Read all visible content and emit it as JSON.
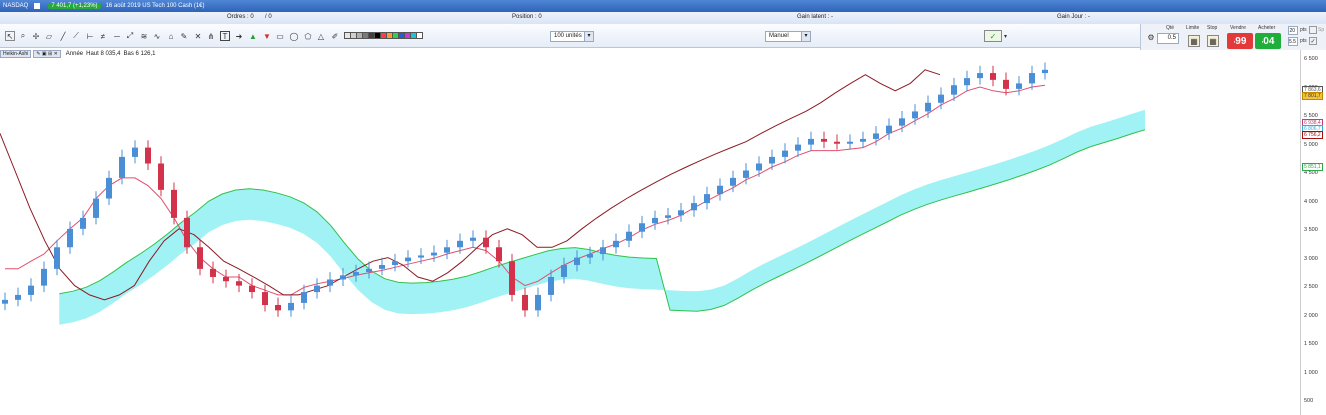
{
  "titlebar": {
    "market": "NASDAQ",
    "price_badge": "7 401,7 (+1,23%)",
    "instrument": "16 août 2019 US Tech 100 Cash (1€)"
  },
  "infobar": {
    "ordres": "Ordres : 0",
    "ordres_sep": "/ 0",
    "position": "Position : 0",
    "gain_latent": "Gain latent : -",
    "gain_jour": "Gain Jour : -"
  },
  "toolbar": {
    "units_dropdown": "100 unités",
    "mode_dropdown": "Manuel",
    "swatches": [
      "#e6e6e6",
      "#d0d0d0",
      "#b0b0b0",
      "#7a7a7a",
      "#404040",
      "#000000",
      "#ff4040",
      "#ff9b2f",
      "#2fd14a",
      "#2a5bd7",
      "#c33dd3",
      "#1fc3d6",
      "#ffffff"
    ]
  },
  "order_panel": {
    "qty_label": "Qté",
    "qty_value": "0.5",
    "limite_label": "Limite",
    "stop_label": "Stop",
    "vendre_label": "Vendre",
    "vendre_value": "99",
    "acheter_label": "Acheter",
    "acheter_value": "04",
    "pts_label": "pts",
    "pts_value_1": "20",
    "pts_value_2": "5.5",
    "sp_label": "Sp",
    "sell_color": "#e23a3a",
    "buy_color": "#1fae3a"
  },
  "chart_header": {
    "style": "Heikin-Ashi",
    "period": "Année",
    "high": "Haut 8 035,4",
    "low": "Bas 6 126,1"
  },
  "y_axis": {
    "ticks": [
      "6 500",
      "6 000",
      "5 500",
      "5 000",
      "4 500",
      "4 000",
      "3 500",
      "3 000",
      "2 500",
      "2 000",
      "1 500",
      "1 000",
      "500"
    ],
    "badges": [
      {
        "text": "7 863,6",
        "color": "#555555"
      },
      {
        "text": "7 801,7",
        "color": "#c08a00"
      },
      {
        "text": "6 938,4",
        "color": "#c04070"
      },
      {
        "text": "6 806,7",
        "color": "#3aa8d8"
      },
      {
        "text": "6 756,2",
        "color": "#a01010"
      },
      {
        "text": "5 851,1",
        "color": "#2fa84a"
      }
    ]
  },
  "chart_data": {
    "type": "candlestick",
    "y_scale": "log",
    "ylim": [
      500,
      8500
    ],
    "series": {
      "price": [
        1250,
        1300,
        1400,
        1600,
        1900,
        2200,
        2400,
        2800,
        3300,
        3900,
        4200,
        3700,
        3000,
        2400,
        1900,
        1600,
        1500,
        1450,
        1400,
        1330,
        1200,
        1150,
        1220,
        1330,
        1400,
        1470,
        1520,
        1560,
        1600,
        1650,
        1700,
        1750,
        1780,
        1820,
        1900,
        2000,
        2050,
        1900,
        1700,
        1300,
        1150,
        1300,
        1500,
        1650,
        1750,
        1800,
        1900,
        2000,
        2150,
        2300,
        2400,
        2450,
        2550,
        2700,
        2900,
        3100,
        3300,
        3500,
        3700,
        3900,
        4100,
        4300,
        4500,
        4400,
        4350,
        4400,
        4500,
        4700,
        5000,
        5300,
        5600,
        6000,
        6400,
        6900,
        7300,
        7600,
        7200,
        6700,
        7000,
        7600,
        7800
      ],
      "red_line": [
        1600,
        1600,
        1700,
        1800,
        2000,
        2200,
        2400,
        2800,
        3100,
        3300,
        3300,
        3100,
        2800,
        2400,
        2000,
        1750,
        1600,
        1500,
        1500,
        1400,
        1350,
        1300,
        1300,
        1380,
        1420,
        1450,
        1480,
        1520,
        1550,
        1580,
        1620,
        1660,
        1700,
        1740,
        1800,
        1850,
        1900,
        1850,
        1700,
        1500,
        1400,
        1450,
        1550,
        1650,
        1730,
        1800,
        1880,
        1950,
        2050,
        2180,
        2280,
        2350,
        2450,
        2600,
        2750,
        2900,
        3050,
        3250,
        3400,
        3600,
        3750,
        3950,
        4100,
        4100,
        4100,
        4150,
        4200,
        4400,
        4700,
        4900,
        5200,
        5500,
        5900,
        6200,
        6600,
        6800,
        6600,
        6500,
        6600,
        6800,
        6900
      ],
      "lagging_line": [
        4700,
        3500,
        2600,
        2000,
        1600,
        1400,
        1300,
        1250,
        1300,
        1400,
        1700,
        2000,
        2200,
        2100,
        1900,
        1700,
        1600,
        1500,
        1400,
        1300,
        1300,
        1350,
        1400,
        1500,
        1600,
        1700,
        1750,
        1650,
        1500,
        1450,
        1550,
        1700,
        1900,
        2100,
        2200,
        2100,
        1900,
        1900,
        2000,
        2200,
        2400,
        2600,
        2800,
        3000,
        3200,
        3400,
        3600,
        3800,
        4000,
        4200,
        4400,
        4700,
        5000,
        5300,
        5600,
        6000,
        6500,
        7000,
        7500,
        7000,
        6600,
        7000,
        7800,
        7500
      ]
    }
  }
}
